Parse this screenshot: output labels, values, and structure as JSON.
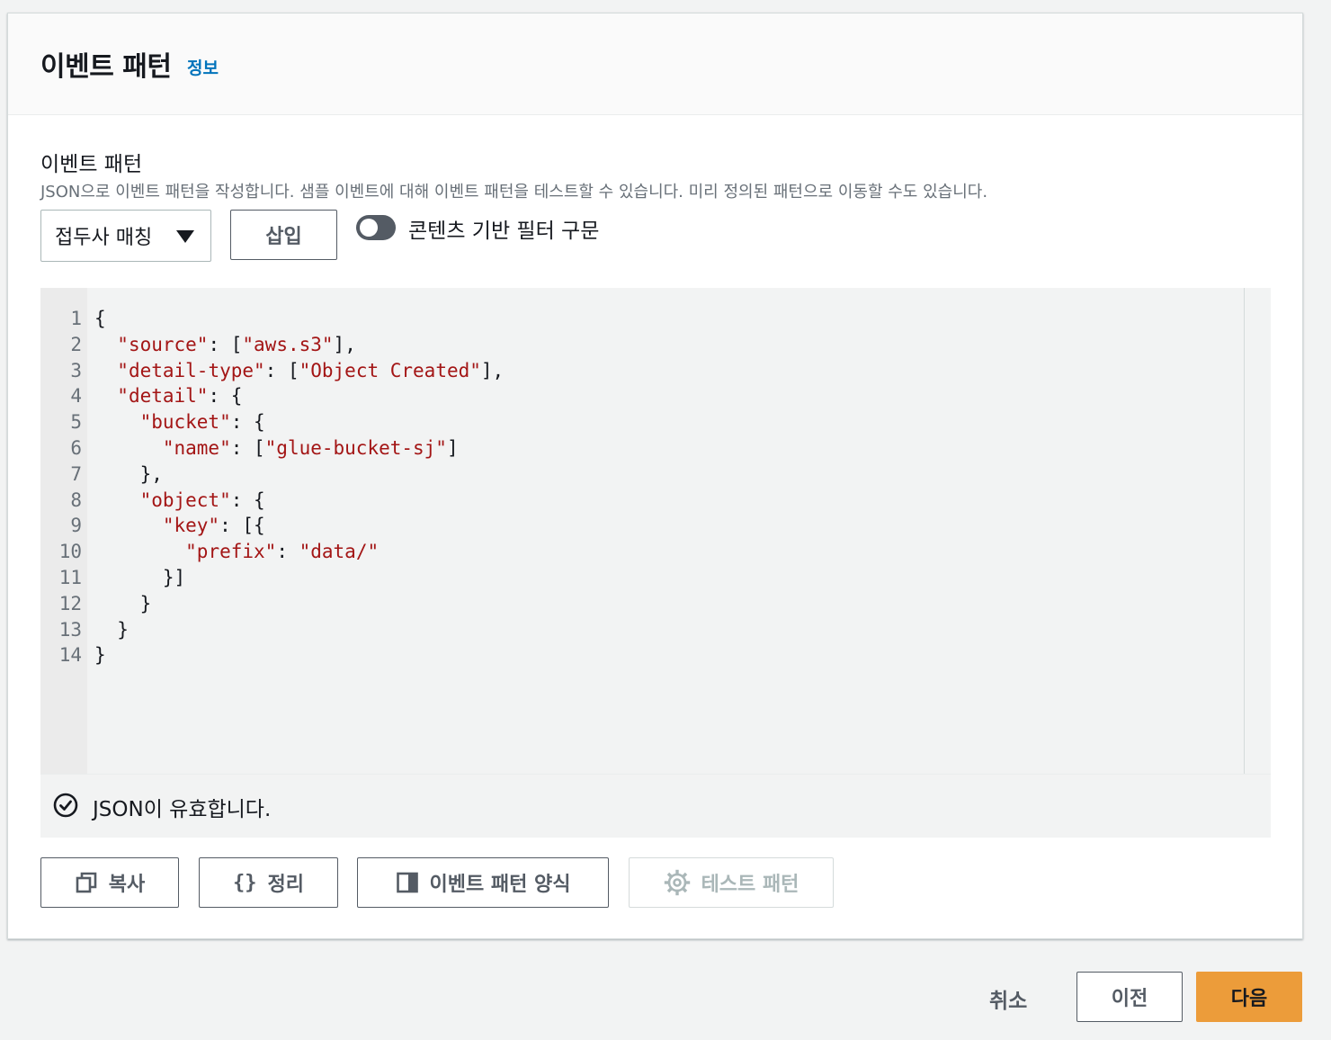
{
  "panel": {
    "title": "이벤트 패턴",
    "info_link": "정보"
  },
  "field": {
    "label": "이벤트 패턴",
    "description": "JSON으로 이벤트 패턴을 작성합니다. 샘플 이벤트에 대해 이벤트 패턴을 테스트할 수 있습니다. 미리 정의된 패턴으로 이동할 수도 있습니다."
  },
  "controls": {
    "select_value": "접두사 매칭",
    "insert_label": "삽입",
    "toggle_label": "콘텐츠 기반 필터 구문",
    "toggle_on": false
  },
  "editor": {
    "line_numbers": [
      "1",
      "2",
      "3",
      "4",
      "5",
      "6",
      "7",
      "8",
      "9",
      "10",
      "11",
      "12",
      "13",
      "14"
    ],
    "lines": [
      [
        {
          "t": "{",
          "s": false
        }
      ],
      [
        {
          "t": "  ",
          "s": false
        },
        {
          "t": "\"source\"",
          "s": true
        },
        {
          "t": ": [",
          "s": false
        },
        {
          "t": "\"aws.s3\"",
          "s": true
        },
        {
          "t": "],",
          "s": false
        }
      ],
      [
        {
          "t": "  ",
          "s": false
        },
        {
          "t": "\"detail-type\"",
          "s": true
        },
        {
          "t": ": [",
          "s": false
        },
        {
          "t": "\"Object Created\"",
          "s": true
        },
        {
          "t": "],",
          "s": false
        }
      ],
      [
        {
          "t": "  ",
          "s": false
        },
        {
          "t": "\"detail\"",
          "s": true
        },
        {
          "t": ": {",
          "s": false
        }
      ],
      [
        {
          "t": "    ",
          "s": false
        },
        {
          "t": "\"bucket\"",
          "s": true
        },
        {
          "t": ": {",
          "s": false
        }
      ],
      [
        {
          "t": "      ",
          "s": false
        },
        {
          "t": "\"name\"",
          "s": true
        },
        {
          "t": ": [",
          "s": false
        },
        {
          "t": "\"glue-bucket-sj\"",
          "s": true
        },
        {
          "t": "]",
          "s": false
        }
      ],
      [
        {
          "t": "    },",
          "s": false
        }
      ],
      [
        {
          "t": "    ",
          "s": false
        },
        {
          "t": "\"object\"",
          "s": true
        },
        {
          "t": ": {",
          "s": false
        }
      ],
      [
        {
          "t": "      ",
          "s": false
        },
        {
          "t": "\"key\"",
          "s": true
        },
        {
          "t": ": [{",
          "s": false
        }
      ],
      [
        {
          "t": "        ",
          "s": false
        },
        {
          "t": "\"prefix\"",
          "s": true
        },
        {
          "t": ": ",
          "s": false
        },
        {
          "t": "\"data/\"",
          "s": true
        }
      ],
      [
        {
          "t": "      }]",
          "s": false
        }
      ],
      [
        {
          "t": "    }",
          "s": false
        }
      ],
      [
        {
          "t": "  }",
          "s": false
        }
      ],
      [
        {
          "t": "}",
          "s": false
        }
      ]
    ],
    "status_text": "JSON이 유효합니다.",
    "string_color": "#a31515"
  },
  "actions": {
    "copy_label": "복사",
    "format_label": "정리",
    "template_label": "이벤트 패턴 양식",
    "test_label": "테스트 패턴"
  },
  "footer": {
    "cancel_label": "취소",
    "prev_label": "이전",
    "next_label": "다음",
    "primary_color": "#ec9c3a"
  }
}
